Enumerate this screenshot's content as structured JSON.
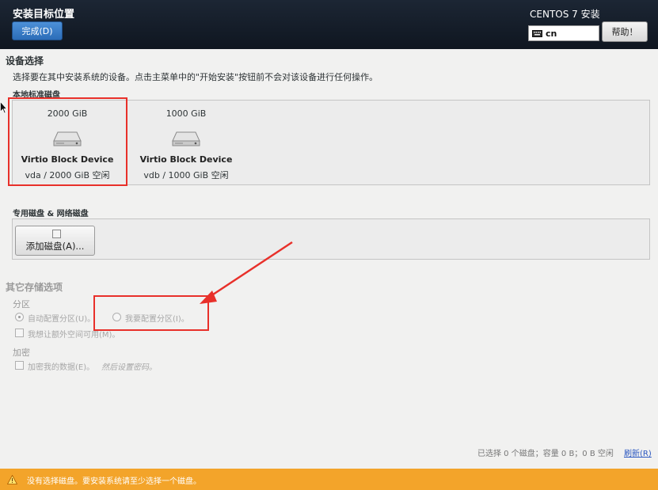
{
  "header": {
    "title": "安装目标位置",
    "done_label": "完成(D)",
    "product": "CENTOS 7 安装",
    "keyboard_layout": "cn",
    "help_label": "帮助！"
  },
  "device_selection": {
    "heading": "设备选择",
    "description": "选择要在其中安装系统的设备。点击主菜单中的\"开始安装\"按钮前不会对该设备进行任何操作。",
    "local_disks_label": "本地标准磁盘",
    "disks": [
      {
        "size": "2000 GiB",
        "model": "Virtio Block Device",
        "info": "vda  /  2000 GiB 空闲",
        "selected": true
      },
      {
        "size": "1000 GiB",
        "model": "Virtio Block Device",
        "info": "vdb  /  1000 GiB 空闲",
        "selected": false
      }
    ],
    "special_disks_label": "专用磁盘 & 网络磁盘",
    "add_disk_label": "添加磁盘(A)..."
  },
  "other_storage": {
    "heading": "其它存储选项",
    "partitioning_label": "分区",
    "auto_partition": "自动配置分区(U)。",
    "manual_partition": "我要配置分区(I)。",
    "extra_space": "我想让额外空间可用(M)。",
    "encryption_label": "加密",
    "encrypt_data": "加密我的数据(E)。",
    "encrypt_hint": "然后设置密码。"
  },
  "footer": {
    "summary": "已选择 0 个磁盘；容量 0 B；0 B 空闲",
    "refresh_label": "刷新(R)",
    "warning": "没有选择磁盘。要安装系统请至少选择一个磁盘。"
  },
  "colors": {
    "header_bg": "#141d29",
    "accent_blue": "#3b7fcf",
    "warning_orange": "#f3a42a",
    "annotation_red": "#e8302a"
  }
}
